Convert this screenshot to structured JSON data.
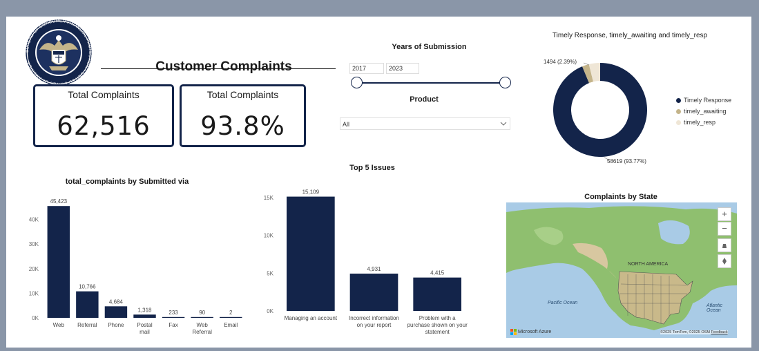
{
  "header": {
    "title": "Customer Complaints",
    "seal_text": "BUREAU OF CONSUMER FINANCIAL PROTECTION • UNITED STATES OF AMERICA"
  },
  "kpis": [
    {
      "label": "Total Complaints",
      "value": "62,516"
    },
    {
      "label": "Total Complaints",
      "value": "93.8%"
    }
  ],
  "filters": {
    "years_title": "Years of Submission",
    "year_start": "2017",
    "year_end": "2023",
    "product_title": "Product",
    "product_value": "All"
  },
  "donut": {
    "title": "Timely Response, timely_awaiting and timely_resp",
    "label_small": "1494 (2.39%)",
    "label_large": "58619 (93.77%)",
    "legend": [
      {
        "name": "Timely Response",
        "color": "#13244a"
      },
      {
        "name": "timely_awaiting",
        "color": "#c4b48a"
      },
      {
        "name": "timely_resp",
        "color": "#efe6d6"
      }
    ]
  },
  "map": {
    "title": "Complaints by State",
    "labels": [
      "NORTH AMERICA",
      "Pacific Ocean",
      "Atlantic Ocean"
    ],
    "branding": "Microsoft Azure",
    "attribution": "©2025 TomTom, ©2025 OSM",
    "feedback": "Feedback",
    "zoom_in": "+",
    "zoom_out": "−"
  },
  "chart_data": [
    {
      "type": "bar",
      "title": "total_complaints by Submitted via",
      "categories": [
        "Web",
        "Referral",
        "Phone",
        "Postal mail",
        "Fax",
        "Web Referral",
        "Email"
      ],
      "values": [
        45423,
        10766,
        4684,
        1318,
        233,
        90,
        2
      ],
      "value_labels": [
        "45,423",
        "10,766",
        "4,684",
        "1,318",
        "233",
        "90",
        "2"
      ],
      "yticks": [
        0,
        10000,
        20000,
        30000,
        40000
      ],
      "ytick_labels": [
        "0K",
        "10K",
        "20K",
        "30K",
        "40K"
      ],
      "ylim": [
        0,
        48000
      ],
      "color": "#13244a"
    },
    {
      "type": "bar",
      "title": "Top 5 Issues",
      "categories": [
        "Managing an account",
        "Incorrect information on your report",
        "Problem with a purchase shown on your statement"
      ],
      "values": [
        15109,
        4931,
        4415
      ],
      "value_labels": [
        "15,109",
        "4,931",
        "4,415"
      ],
      "yticks": [
        0,
        5000,
        10000,
        15000
      ],
      "ytick_labels": [
        "0K",
        "5K",
        "10K",
        "15K"
      ],
      "ylim": [
        0,
        15800
      ],
      "color": "#13244a"
    },
    {
      "type": "pie",
      "title": "Timely Response, timely_awaiting and timely_resp",
      "categories": [
        "Timely Response",
        "timely_awaiting",
        "timely_resp"
      ],
      "values": [
        58619,
        1494,
        2403
      ]
    }
  ]
}
